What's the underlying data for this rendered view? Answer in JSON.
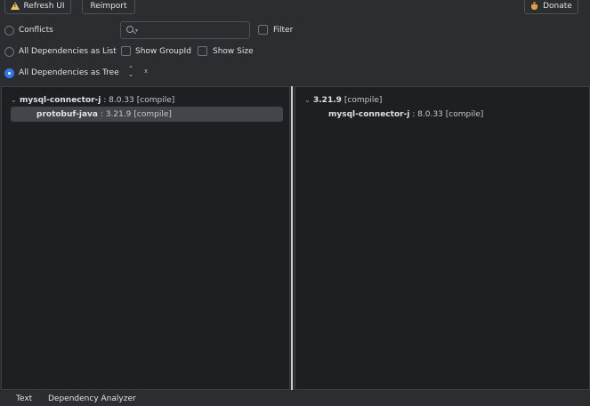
{
  "toolbar": {
    "refresh_label": "Refresh UI",
    "reimport_label": "Reimport",
    "donate_label": "Donate"
  },
  "options": {
    "conflicts_label": "Conflicts",
    "filter_label": "Filter",
    "list_label": "All Dependencies as List",
    "show_groupid_label": "Show GroupId",
    "show_size_label": "Show Size",
    "tree_label": "All Dependencies as Tree",
    "selected_mode": "tree"
  },
  "search": {
    "value": "",
    "placeholder": ""
  },
  "left_tree": {
    "root": {
      "name": "mysql-connector-j",
      "sep": " : ",
      "version": "8.0.33",
      "scope": "[compile]"
    },
    "child": {
      "name": "protobuf-java",
      "sep": " : ",
      "version": "3.21.9",
      "scope": "[compile]"
    }
  },
  "right_tree": {
    "root": {
      "version": "3.21.9",
      "scope": "[compile]"
    },
    "child": {
      "name": "mysql-connector-j",
      "sep": " : ",
      "version": "8.0.33",
      "scope": "[compile]"
    }
  },
  "bottom_tabs": [
    "Text",
    "Dependency Analyzer"
  ],
  "colors": {
    "accent": "#3574f0",
    "background": "#2b2d30",
    "panel": "#1e1f22",
    "warning": "#f2c55c"
  }
}
